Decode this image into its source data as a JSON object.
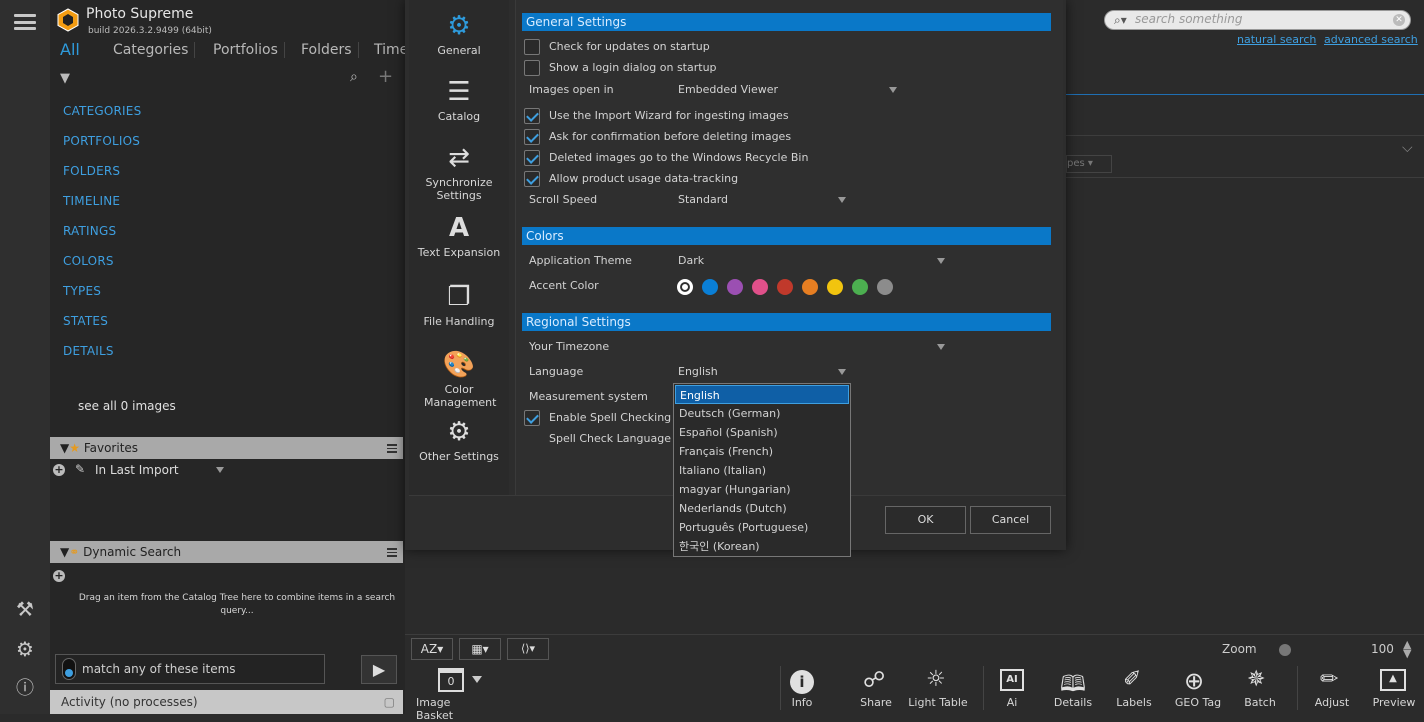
{
  "app": {
    "name": "Photo Supreme",
    "build": "build 2026.3.2.9499 (64bit)"
  },
  "tabs": [
    "All",
    "Categories",
    "Portfolios",
    "Folders",
    "Timel"
  ],
  "tree": [
    "CATEGORIES",
    "PORTFOLIOS",
    "FOLDERS",
    "TIMELINE",
    "RATINGS",
    "COLORS",
    "TYPES",
    "STATES",
    "DETAILS"
  ],
  "see_all": "see all 0 images",
  "favorites": {
    "title": "Favorites",
    "item": "In Last Import"
  },
  "dynamic_search": {
    "title": "Dynamic Search",
    "hint": "Drag an item from the Catalog Tree here to combine items in a search query...",
    "match": "match any of these items"
  },
  "activity": "Activity (no processes)",
  "search": {
    "placeholder": "search something",
    "natural": "natural search",
    "advanced": "advanced search"
  },
  "right_fragments": {
    "types": "pes"
  },
  "dialog": {
    "nav": [
      "General",
      "Catalog",
      "Synchronize Settings",
      "Text Expansion",
      "File Handling",
      "Color Management",
      "Other Settings"
    ],
    "sections": {
      "general": "General Settings",
      "colors": "Colors",
      "regional": "Regional Settings"
    },
    "general": {
      "check_updates": "Check for updates on startup",
      "login_dialog": "Show a login dialog on startup",
      "images_open_label": "Images open in",
      "images_open_value": "Embedded Viewer",
      "import_wizard": "Use the Import Wizard for ingesting images",
      "confirm_delete": "Ask for confirmation before deleting images",
      "recycle_bin": "Deleted images go to the Windows Recycle Bin",
      "data_tracking": "Allow product usage data-tracking",
      "scroll_label": "Scroll Speed",
      "scroll_value": "Standard"
    },
    "colors": {
      "theme_label": "Application Theme",
      "theme_value": "Dark",
      "accent_label": "Accent Color",
      "accent_colors": [
        "#ffffff",
        "#0a7fd6",
        "#9b4fb2",
        "#e0508a",
        "#c0392b",
        "#e67e22",
        "#f1c40f",
        "#4caf50",
        "#8c8c8c"
      ]
    },
    "regional": {
      "timezone_label": "Your Timezone",
      "language_label": "Language",
      "language_value": "English",
      "measurement_label": "Measurement system",
      "spell_check": "Enable Spell Checking",
      "spell_lang": "Spell Check Language"
    },
    "language_options": [
      "English",
      "Deutsch (German)",
      "Español (Spanish)",
      "Français (French)",
      "Italiano (Italian)",
      "magyar (Hungarian)",
      "Nederlands (Dutch)",
      "Português (Portuguese)",
      "한국인 (Korean)"
    ],
    "ok": "OK",
    "cancel": "Cancel"
  },
  "bottom": {
    "zoom_label": "Zoom",
    "zoom_value": "100",
    "basket_count": "0",
    "labels": [
      "Image Basket",
      "Info",
      "Share",
      "Light Table",
      "Ai",
      "Details",
      "Labels",
      "GEO Tag",
      "Batch",
      "Adjust",
      "Preview"
    ]
  }
}
